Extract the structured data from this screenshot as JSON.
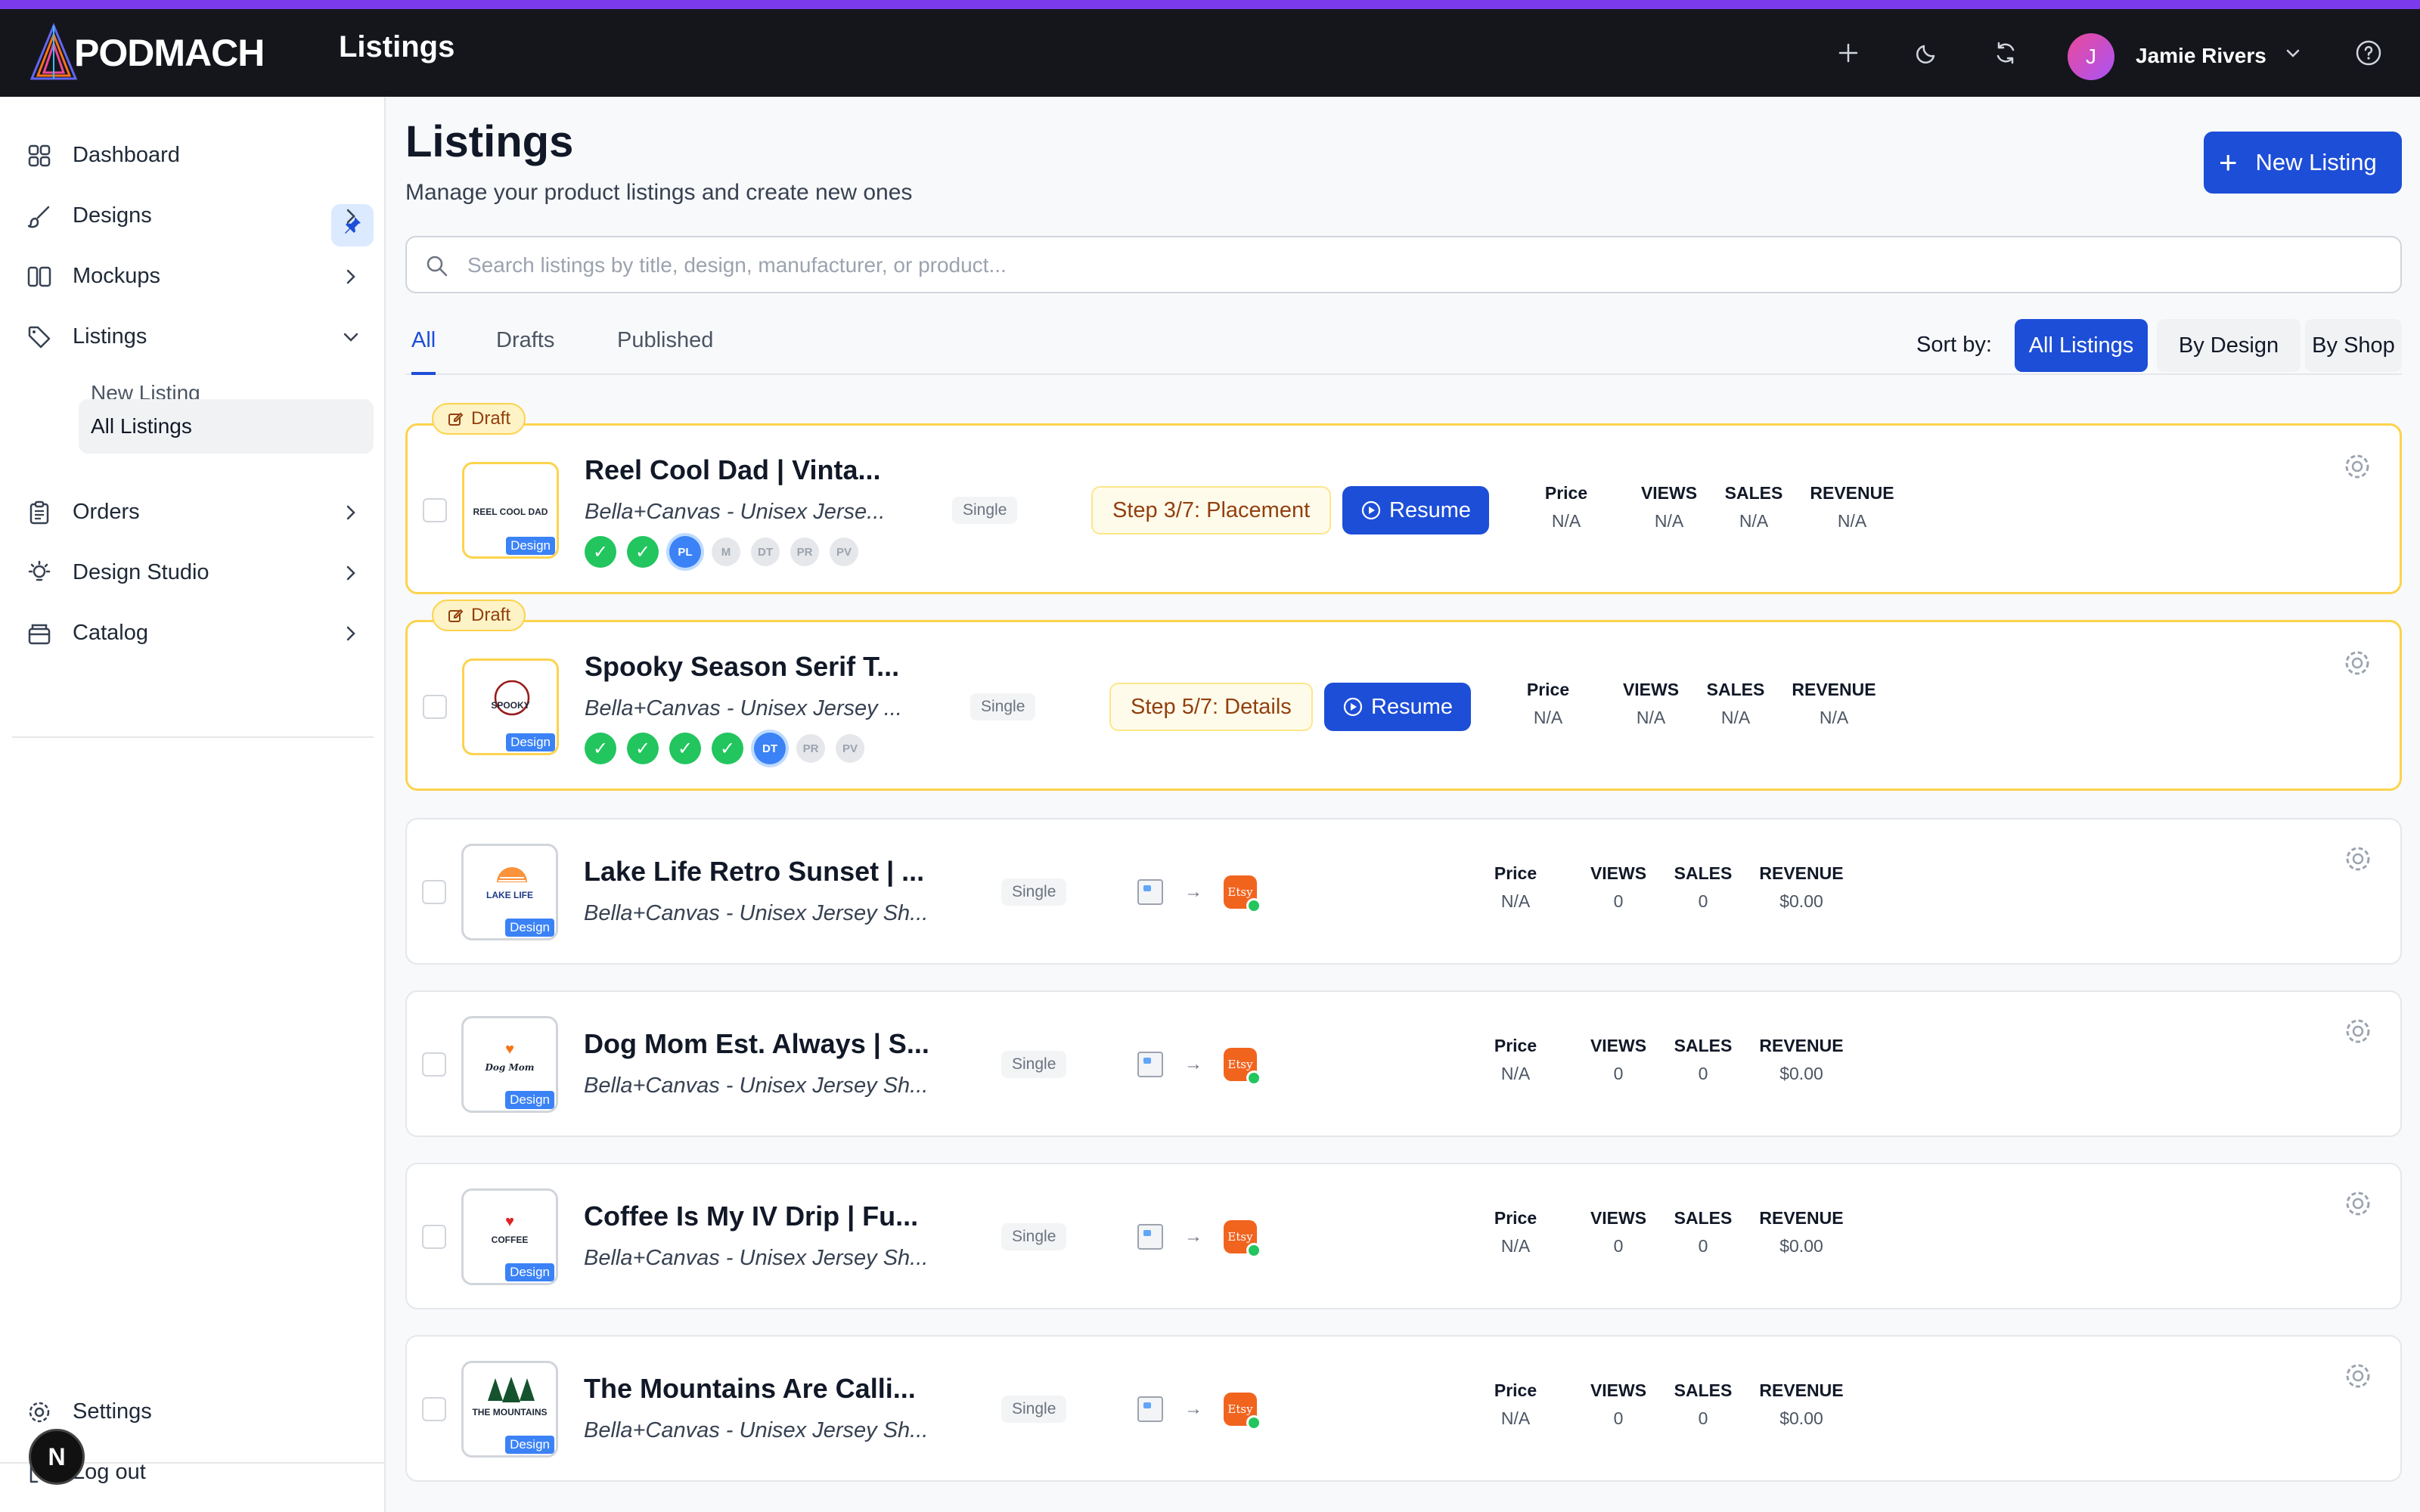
{
  "app": {
    "brand": "PODMACH",
    "page_title": "Listings",
    "user_name": "Jamie Rivers",
    "user_initial": "J",
    "accent_color": "#7c3aed",
    "primary_color": "#1d4ed8"
  },
  "sidebar": {
    "items": [
      {
        "label": "Dashboard",
        "icon": "dashboard-icon"
      },
      {
        "label": "Designs",
        "icon": "brush-icon"
      },
      {
        "label": "Mockups",
        "icon": "columns-icon"
      },
      {
        "label": "Listings",
        "icon": "tag-icon",
        "expanded": true
      },
      {
        "label": "Orders",
        "icon": "clipboard-icon"
      },
      {
        "label": "Design Studio",
        "icon": "lightbulb-icon"
      },
      {
        "label": "Catalog",
        "icon": "box-icon"
      }
    ],
    "sub_items": [
      {
        "label": "New Listing"
      },
      {
        "label": "All Listings",
        "active": true
      }
    ],
    "settings_label": "Settings",
    "logout_label": "Log out",
    "floating_badge": "N"
  },
  "main": {
    "title": "Listings",
    "subtitle": "Manage your product listings and create new ones",
    "new_button": "New Listing",
    "search_placeholder": "Search listings by title, design, manufacturer, or product...",
    "tabs": [
      {
        "label": "All",
        "active": true
      },
      {
        "label": "Drafts"
      },
      {
        "label": "Published"
      }
    ],
    "sort_label": "Sort by:",
    "sort_options": [
      {
        "label": "All Listings",
        "active": true
      },
      {
        "label": "By Design"
      },
      {
        "label": "By Shop"
      }
    ]
  },
  "stat_labels": {
    "price": "Price",
    "views": "VIEWS",
    "sales": "SALES",
    "revenue": "REVENUE"
  },
  "listings": [
    {
      "status": "Draft",
      "title": "Reel Cool Dad | Vinta...",
      "subtitle": "Bella+Canvas - Unisex Jerse...",
      "type": "Single",
      "thumb_text": "REEL COOL DAD",
      "thumb_design": "Design",
      "steps": [
        "done",
        "done",
        "PL",
        "M",
        "DT",
        "PR",
        "PV"
      ],
      "step_label": "Step 3/7: Placement",
      "resume": "Resume",
      "price": "N/A",
      "views": "N/A",
      "sales": "N/A",
      "revenue": "N/A"
    },
    {
      "status": "Draft",
      "title": "Spooky Season Serif T...",
      "subtitle": "Bella+Canvas - Unisex Jersey ...",
      "type": "Single",
      "thumb_text": "SPOOKY",
      "thumb_design": "Design",
      "steps": [
        "done",
        "done",
        "done",
        "done",
        "DT",
        "PR",
        "PV"
      ],
      "step_label": "Step 5/7: Details",
      "resume": "Resume",
      "price": "N/A",
      "views": "N/A",
      "sales": "N/A",
      "revenue": "N/A"
    },
    {
      "status": "Published",
      "title": "Lake Life Retro Sunset | ...",
      "subtitle": "Bella+Canvas - Unisex Jersey Sh...",
      "type": "Single",
      "thumb_text": "LAKE LIFE",
      "thumb_design": "Design",
      "shop": "Etsy",
      "price": "N/A",
      "views": "0",
      "sales": "0",
      "revenue": "$0.00"
    },
    {
      "status": "Published",
      "title": "Dog Mom Est. Always | S...",
      "subtitle": "Bella+Canvas - Unisex Jersey Sh...",
      "type": "Single",
      "thumb_text": "Dog Mom",
      "thumb_design": "Design",
      "shop": "Etsy",
      "price": "N/A",
      "views": "0",
      "sales": "0",
      "revenue": "$0.00"
    },
    {
      "status": "Published",
      "title": "Coffee Is My IV Drip | Fu...",
      "subtitle": "Bella+Canvas - Unisex Jersey Sh...",
      "type": "Single",
      "thumb_text": "COFFEE",
      "thumb_design": "Design",
      "shop": "Etsy",
      "price": "N/A",
      "views": "0",
      "sales": "0",
      "revenue": "$0.00"
    },
    {
      "status": "Published",
      "title": "The Mountains Are Calli...",
      "subtitle": "Bella+Canvas - Unisex Jersey Sh...",
      "type": "Single",
      "thumb_text": "THE MOUNTAINS",
      "thumb_design": "Design",
      "shop": "Etsy",
      "price": "N/A",
      "views": "0",
      "sales": "0",
      "revenue": "$0.00"
    }
  ]
}
